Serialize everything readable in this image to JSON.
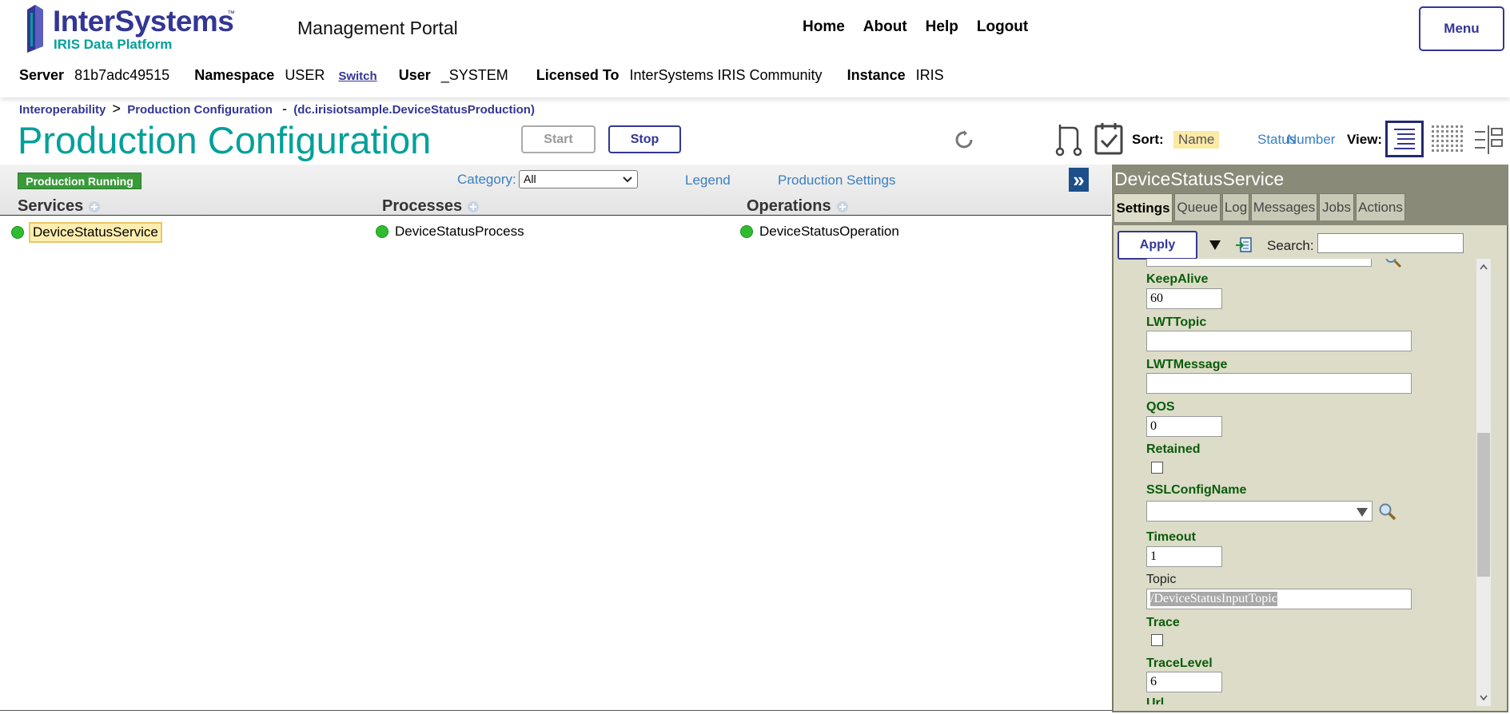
{
  "header": {
    "logo_main": "InterSystems",
    "logo_tm": "™",
    "logo_sub": "IRIS Data Platform",
    "portal_title": "Management Portal",
    "nav": [
      {
        "label": "Home"
      },
      {
        "label": "About"
      },
      {
        "label": "Help"
      },
      {
        "label": "Logout"
      }
    ],
    "menu_label": "Menu"
  },
  "info_bar": {
    "server_label": "Server",
    "server_value": "81b7adc49515",
    "namespace_label": "Namespace",
    "namespace_value": "USER",
    "switch_label": "Switch",
    "user_label": "User",
    "user_value": "_SYSTEM",
    "licensed_label": "Licensed To",
    "licensed_value": "InterSystems IRIS Community",
    "instance_label": "Instance",
    "instance_value": "IRIS"
  },
  "breadcrumb": {
    "item1": "Interoperability",
    "sep": ">",
    "item2": "Production Configuration",
    "dash": "-",
    "production": "(dc.irisiotsample.DeviceStatusProduction)"
  },
  "page": {
    "title": "Production Configuration",
    "start_label": "Start",
    "stop_label": "Stop",
    "sort_label": "Sort:",
    "sort_options": [
      "Name",
      "Status",
      "Number"
    ],
    "view_label": "View:"
  },
  "toolbar": {
    "status_badge": "Production Running",
    "category_label": "Category:",
    "category_value": "All",
    "legend_link": "Legend",
    "settings_link": "Production Settings",
    "expand_glyph": "»"
  },
  "columns": {
    "services": {
      "header": "Services",
      "items": [
        "DeviceStatusService"
      ]
    },
    "processes": {
      "header": "Processes",
      "items": [
        "DeviceStatusProcess"
      ]
    },
    "operations": {
      "header": "Operations",
      "items": [
        "DeviceStatusOperation"
      ]
    }
  },
  "panel": {
    "title": "DeviceStatusService",
    "tabs": [
      {
        "label": "Settings"
      },
      {
        "label": "Queue"
      },
      {
        "label": "Log"
      },
      {
        "label": "Messages"
      },
      {
        "label": "Jobs"
      },
      {
        "label": "Actions"
      }
    ],
    "apply_label": "Apply",
    "search_label": "Search:",
    "search_value": "",
    "properties": {
      "keepalive_label": "KeepAlive",
      "keepalive_value": "60",
      "lwttopic_label": "LWTTopic",
      "lwttopic_value": "",
      "lwtmessage_label": "LWTMessage",
      "lwtmessage_value": "",
      "qos_label": "QOS",
      "qos_value": "0",
      "retained_label": "Retained",
      "sslconfig_label": "SSLConfigName",
      "sslconfig_value": "",
      "timeout_label": "Timeout",
      "timeout_value": "1",
      "topic_label": "Topic",
      "topic_value": "/DeviceStatusInputTopic",
      "trace_label": "Trace",
      "tracelevel_label": "TraceLevel",
      "tracelevel_value": "6",
      "url_label": "Url"
    }
  },
  "colors": {
    "brand": "#333695",
    "teal": "#00a09a",
    "link": "#3a7fc1",
    "running_green": "#3a9a3a",
    "panel_bg": "#dcdcc8",
    "panel_dark": "#7a7a6a",
    "prop_green": "#0b5c0b"
  }
}
